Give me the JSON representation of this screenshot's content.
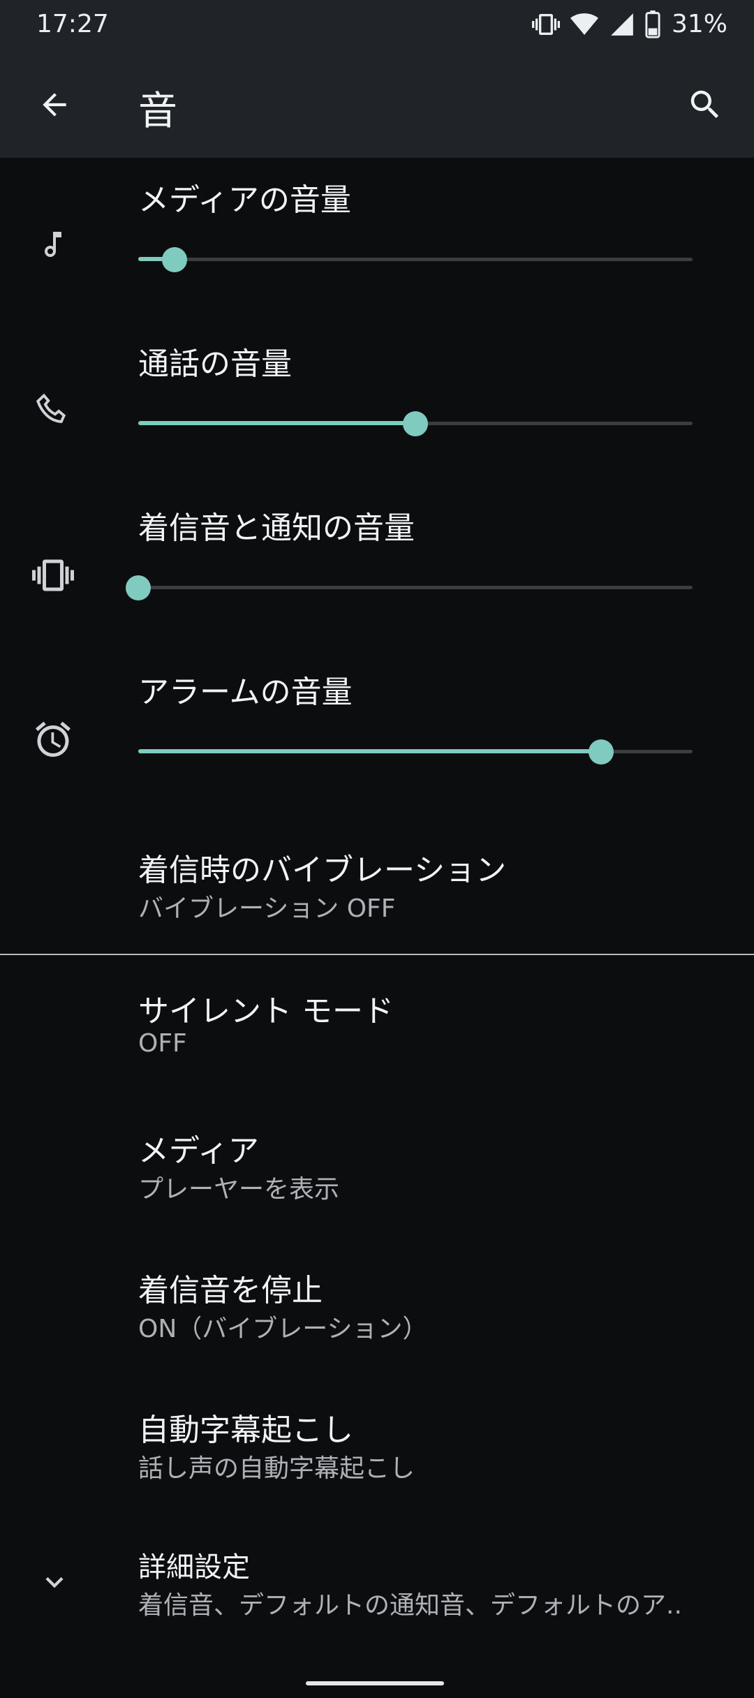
{
  "status": {
    "time": "17:27",
    "battery": "31%"
  },
  "appbar": {
    "title": "音"
  },
  "volumes": [
    {
      "label": "メディアの音量",
      "icon": "music-note-icon",
      "level": 0.065
    },
    {
      "label": "通話の音量",
      "icon": "phone-icon",
      "level": 0.5
    },
    {
      "label": "着信音と通知の音量",
      "icon": "vibrate-icon",
      "level": 0.0
    },
    {
      "label": "アラームの音量",
      "icon": "alarm-icon",
      "level": 0.835
    }
  ],
  "prefs": {
    "vibration": {
      "title": "着信時のバイブレーション",
      "subtitle": "バイブレーション OFF"
    },
    "silent": {
      "title": "サイレント モード",
      "subtitle": "OFF"
    },
    "media": {
      "title": "メディア",
      "subtitle": "プレーヤーを表示"
    },
    "stop_ring": {
      "title": "着信音を停止",
      "subtitle": "ON（バイブレーション）"
    },
    "live_caption": {
      "title": "自動字幕起こし",
      "subtitle": "話し声の自動字幕起こし"
    },
    "advanced": {
      "title": "詳細設定",
      "subtitle": "着信音、デフォルトの通知音、デフォルトのア.."
    }
  },
  "colors": {
    "accent": "#7fcbbf",
    "background": "#0c0d0f",
    "appbar": "#202328"
  }
}
